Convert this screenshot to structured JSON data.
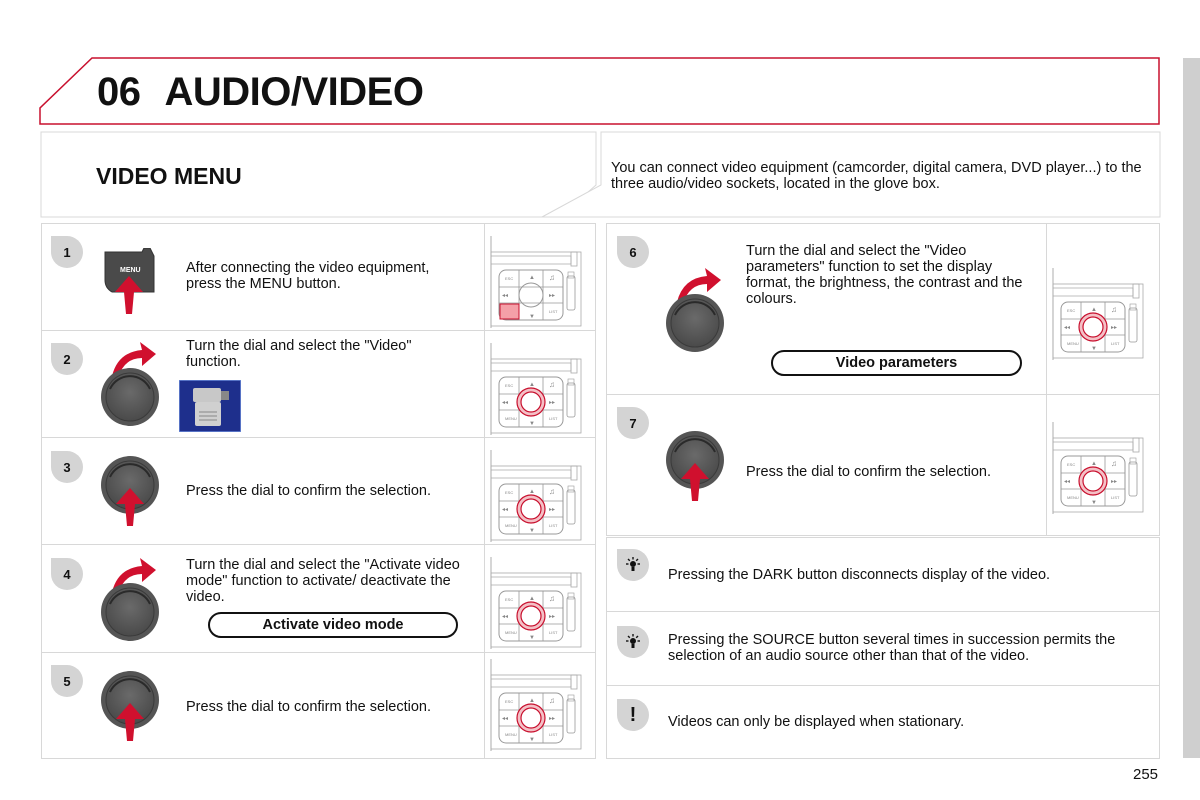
{
  "header": {
    "chapter_number": "06",
    "chapter_title": "AUDIO/VIDEO",
    "accent_color": "#c8102e"
  },
  "section": {
    "title": "VIDEO MENU",
    "intro": "You can connect video equipment (camcorder, digital camera, DVD player...) to the three audio/video sockets, located in the glove box."
  },
  "steps": [
    {
      "number": "1",
      "text": "After connecting the video equipment, press the MENU button.",
      "icon": "menu-button-press-icon",
      "menu_label": "MENU"
    },
    {
      "number": "2",
      "text": "Turn the dial and select the \"Video\" function.",
      "icon": "dial-turn-icon"
    },
    {
      "number": "3",
      "text": "Press the dial to confirm the selection.",
      "icon": "dial-press-icon"
    },
    {
      "number": "4",
      "text": "Turn the dial and select the \"Activate video mode\" function to activate/ deactivate the video.",
      "icon": "dial-turn-icon",
      "option_label": "Activate video mode"
    },
    {
      "number": "5",
      "text": "Press the dial to confirm the selection.",
      "icon": "dial-press-icon"
    },
    {
      "number": "6",
      "text": "Turn the dial and select the \"Video parameters\" function to set the display format, the brightness, the contrast and the colours.",
      "icon": "dial-turn-icon",
      "option_label": "Video parameters"
    },
    {
      "number": "7",
      "text": "Press the dial to confirm the selection.",
      "icon": "dial-press-icon"
    }
  ],
  "panel_labels": {
    "esc": "ESC",
    "menu": "MENU",
    "list": "LIST"
  },
  "notes": [
    {
      "icon": "tip-lightbulb-icon",
      "text": "Pressing the DARK button disconnects display of the video."
    },
    {
      "icon": "tip-lightbulb-icon",
      "text": "Pressing the SOURCE button several times in succession permits the selection of an audio source other than that of the video."
    },
    {
      "icon": "warning-exclamation-icon",
      "symbol": "!",
      "text": "Videos can only be displayed when stationary."
    }
  ],
  "page_number": "255"
}
